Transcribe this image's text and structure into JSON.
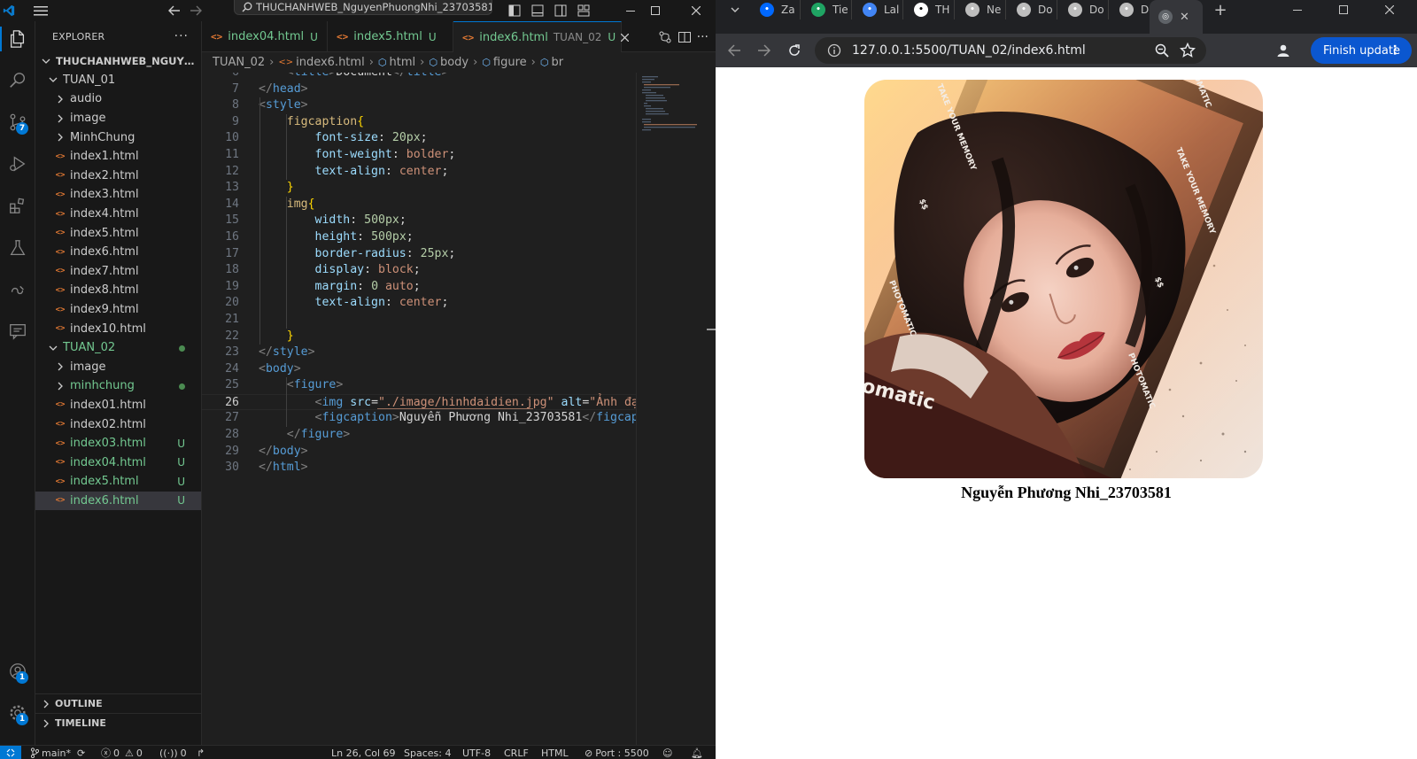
{
  "vscode": {
    "command_center": "THUCHANHWEB_NguyenPhuongNhi_23703581",
    "explorer_title": "EXPLORER",
    "root_folder": "THUCHANHWEB_NGUYENPH...",
    "scm_badge": "7",
    "accounts_badge": "1",
    "settings_badge": "1",
    "tree": [
      {
        "label": "TUAN_01",
        "type": "folder-open",
        "depth": 1
      },
      {
        "label": "audio",
        "type": "folder",
        "depth": 2
      },
      {
        "label": "image",
        "type": "folder",
        "depth": 2
      },
      {
        "label": "MinhChung",
        "type": "folder",
        "depth": 2
      },
      {
        "label": "index1.html",
        "type": "file",
        "depth": 2
      },
      {
        "label": "index2.html",
        "type": "file",
        "depth": 2
      },
      {
        "label": "index3.html",
        "type": "file",
        "depth": 2
      },
      {
        "label": "index4.html",
        "type": "file",
        "depth": 2
      },
      {
        "label": "index5.html",
        "type": "file",
        "depth": 2
      },
      {
        "label": "index6.html",
        "type": "file",
        "depth": 2
      },
      {
        "label": "index7.html",
        "type": "file",
        "depth": 2
      },
      {
        "label": "index8.html",
        "type": "file",
        "depth": 2
      },
      {
        "label": "index9.html",
        "type": "file",
        "depth": 2
      },
      {
        "label": "index10.html",
        "type": "file",
        "depth": 2
      },
      {
        "label": "TUAN_02",
        "type": "folder-open",
        "depth": 1,
        "status": "dot",
        "color": "#73c991"
      },
      {
        "label": "image",
        "type": "folder",
        "depth": 2
      },
      {
        "label": "minhchung",
        "type": "folder",
        "depth": 2,
        "status": "dot",
        "color": "#73c991"
      },
      {
        "label": "index01.html",
        "type": "file",
        "depth": 2
      },
      {
        "label": "index02.html",
        "type": "file",
        "depth": 2
      },
      {
        "label": "index03.html",
        "type": "file",
        "depth": 2,
        "status": "U",
        "color": "#73c991"
      },
      {
        "label": "index04.html",
        "type": "file",
        "depth": 2,
        "status": "U",
        "color": "#73c991"
      },
      {
        "label": "index5.html",
        "type": "file",
        "depth": 2,
        "status": "U",
        "color": "#73c991"
      },
      {
        "label": "index6.html",
        "type": "file",
        "depth": 2,
        "status": "U",
        "color": "#73c991",
        "selected": true
      }
    ],
    "outline_label": "OUTLINE",
    "timeline_label": "TIMELINE",
    "tabs": [
      {
        "name": "index04.html",
        "status": "U"
      },
      {
        "name": "index5.html",
        "status": "U"
      },
      {
        "name": "index6.html",
        "dir": "TUAN_02",
        "status": "U",
        "active": true
      }
    ],
    "breadcrumb": [
      "TUAN_02",
      "index6.html",
      "html",
      "body",
      "figure",
      "br"
    ],
    "code_lines": [
      {
        "n": "6",
        "tokens": [
          [
            "k-txt",
            "    "
          ],
          [
            "k-br",
            "<"
          ],
          [
            "k-tag",
            "title"
          ],
          [
            "k-br",
            ">"
          ],
          [
            "k-txt",
            "Document"
          ],
          [
            "k-br",
            "</"
          ],
          [
            "k-tag",
            "title"
          ],
          [
            "k-br",
            ">"
          ]
        ]
      },
      {
        "n": "7",
        "tokens": [
          [
            "k-br",
            "</"
          ],
          [
            "k-tag",
            "head"
          ],
          [
            "k-br",
            ">"
          ]
        ]
      },
      {
        "n": "8",
        "tokens": [
          [
            "k-br",
            "<"
          ],
          [
            "k-tag",
            "style"
          ],
          [
            "k-br",
            ">"
          ]
        ]
      },
      {
        "n": "9",
        "tokens": [
          [
            "k-txt",
            "    "
          ],
          [
            "k-sel",
            "figcaption"
          ],
          [
            "k-brace",
            "{"
          ]
        ]
      },
      {
        "n": "10",
        "tokens": [
          [
            "k-txt",
            "        "
          ],
          [
            "k-prop",
            "font-size"
          ],
          [
            "k-txt",
            ": "
          ],
          [
            "k-num",
            "20px"
          ],
          [
            "k-txt",
            ";"
          ]
        ]
      },
      {
        "n": "11",
        "tokens": [
          [
            "k-txt",
            "        "
          ],
          [
            "k-prop",
            "font-weight"
          ],
          [
            "k-txt",
            ": "
          ],
          [
            "k-val",
            "bolder"
          ],
          [
            "k-txt",
            ";"
          ]
        ]
      },
      {
        "n": "12",
        "tokens": [
          [
            "k-txt",
            "        "
          ],
          [
            "k-prop",
            "text-align"
          ],
          [
            "k-txt",
            ": "
          ],
          [
            "k-val",
            "center"
          ],
          [
            "k-txt",
            ";"
          ]
        ]
      },
      {
        "n": "13",
        "tokens": [
          [
            "k-txt",
            "    "
          ],
          [
            "k-brace",
            "}"
          ]
        ]
      },
      {
        "n": "14",
        "tokens": [
          [
            "k-txt",
            "    "
          ],
          [
            "k-sel",
            "img"
          ],
          [
            "k-brace",
            "{"
          ]
        ]
      },
      {
        "n": "15",
        "tokens": [
          [
            "k-txt",
            "        "
          ],
          [
            "k-prop",
            "width"
          ],
          [
            "k-txt",
            ": "
          ],
          [
            "k-num",
            "500px"
          ],
          [
            "k-txt",
            ";"
          ]
        ]
      },
      {
        "n": "16",
        "tokens": [
          [
            "k-txt",
            "        "
          ],
          [
            "k-prop",
            "height"
          ],
          [
            "k-txt",
            ": "
          ],
          [
            "k-num",
            "500px"
          ],
          [
            "k-txt",
            ";"
          ]
        ]
      },
      {
        "n": "17",
        "tokens": [
          [
            "k-txt",
            "        "
          ],
          [
            "k-prop",
            "border-radius"
          ],
          [
            "k-txt",
            ": "
          ],
          [
            "k-num",
            "25px"
          ],
          [
            "k-txt",
            ";"
          ]
        ]
      },
      {
        "n": "18",
        "tokens": [
          [
            "k-txt",
            "        "
          ],
          [
            "k-prop",
            "display"
          ],
          [
            "k-txt",
            ": "
          ],
          [
            "k-val",
            "block"
          ],
          [
            "k-txt",
            ";"
          ]
        ]
      },
      {
        "n": "19",
        "tokens": [
          [
            "k-txt",
            "        "
          ],
          [
            "k-prop",
            "margin"
          ],
          [
            "k-txt",
            ": "
          ],
          [
            "k-num",
            "0"
          ],
          [
            "k-txt",
            " "
          ],
          [
            "k-val",
            "auto"
          ],
          [
            "k-txt",
            ";"
          ]
        ]
      },
      {
        "n": "20",
        "tokens": [
          [
            "k-txt",
            "        "
          ],
          [
            "k-prop",
            "text-align"
          ],
          [
            "k-txt",
            ": "
          ],
          [
            "k-val",
            "center"
          ],
          [
            "k-txt",
            ";"
          ]
        ]
      },
      {
        "n": "21",
        "tokens": []
      },
      {
        "n": "22",
        "tokens": [
          [
            "k-txt",
            "    "
          ],
          [
            "k-brace",
            "}"
          ]
        ]
      },
      {
        "n": "23",
        "tokens": [
          [
            "k-br",
            "</"
          ],
          [
            "k-tag",
            "style"
          ],
          [
            "k-br",
            ">"
          ]
        ]
      },
      {
        "n": "24",
        "tokens": [
          [
            "k-br",
            "<"
          ],
          [
            "k-tag",
            "body"
          ],
          [
            "k-br",
            ">"
          ]
        ]
      },
      {
        "n": "25",
        "tokens": [
          [
            "k-txt",
            "    "
          ],
          [
            "k-br",
            "<"
          ],
          [
            "k-tag",
            "figure"
          ],
          [
            "k-br",
            ">"
          ]
        ]
      },
      {
        "n": "26",
        "current": true,
        "tokens": [
          [
            "k-txt",
            "        "
          ],
          [
            "k-br",
            "<"
          ],
          [
            "k-tag",
            "img"
          ],
          [
            "k-txt",
            " "
          ],
          [
            "k-attr",
            "src"
          ],
          [
            "k-txt",
            "="
          ],
          [
            "k-str",
            "\"./image/hinhdaidien.jpg\""
          ],
          [
            "k-txt",
            " "
          ],
          [
            "k-attr",
            "alt"
          ],
          [
            "k-txt",
            "="
          ],
          [
            "k-str",
            "\"Ảnh đại di"
          ]
        ]
      },
      {
        "n": "27",
        "tokens": [
          [
            "k-txt",
            "        "
          ],
          [
            "k-br",
            "<"
          ],
          [
            "k-tag",
            "figcaption"
          ],
          [
            "k-br",
            ">"
          ],
          [
            "k-txt",
            "Nguyễn Phương Nhi_23703581"
          ],
          [
            "k-br",
            "</"
          ],
          [
            "k-tag",
            "figcaption"
          ],
          [
            "k-br",
            ">"
          ]
        ]
      },
      {
        "n": "28",
        "tokens": [
          [
            "k-txt",
            "    "
          ],
          [
            "k-br",
            "</"
          ],
          [
            "k-tag",
            "figure"
          ],
          [
            "k-br",
            ">"
          ]
        ]
      },
      {
        "n": "29",
        "tokens": [
          [
            "k-br",
            "</"
          ],
          [
            "k-tag",
            "body"
          ],
          [
            "k-br",
            ">"
          ]
        ]
      },
      {
        "n": "30",
        "tokens": [
          [
            "k-br",
            "</"
          ],
          [
            "k-tag",
            "html"
          ],
          [
            "k-br",
            ">"
          ]
        ]
      }
    ],
    "status": {
      "branch": "main*",
      "errors": "0",
      "warnings": "0",
      "ports": "0",
      "position": "Ln 26, Col 69",
      "spaces": "Spaces: 4",
      "encoding": "UTF-8",
      "eol": "CRLF",
      "language": "HTML",
      "port": "Port : 5500"
    }
  },
  "chrome": {
    "tabs": [
      {
        "label": "Za",
        "icon": "zalo-icon",
        "color": "#0068ff"
      },
      {
        "label": "Tie",
        "icon": "drive-icon",
        "color": "#1fa463"
      },
      {
        "label": "Lal",
        "icon": "docs-icon",
        "color": "#4285f4"
      },
      {
        "label": "TH",
        "icon": "github-icon",
        "color": "#ffffff"
      },
      {
        "label": "Ne",
        "icon": "chrome-icon",
        "color": "#bdbdbd"
      },
      {
        "label": "Do",
        "icon": "globe-icon",
        "color": "#bdbdbd"
      },
      {
        "label": "Do",
        "icon": "globe-icon",
        "color": "#bdbdbd"
      },
      {
        "label": "Do",
        "icon": "globe-icon",
        "color": "#bdbdbd"
      }
    ],
    "url": "127.0.0.1:5500/TUAN_02/index6.html",
    "finish_update": "Finish update",
    "page": {
      "image_alt": "Ảnh đại diện",
      "caption": "Nguyễn Phương Nhi_23703581",
      "photo_text_1": "TAKE YOUR MEMORY",
      "photo_text_2": "TAKE YOUR MEMORY",
      "photo_text_3": "PHOTOMATIC",
      "photo_text_4": "PHOTOMATIC",
      "photo_text_5": "omatic",
      "photo_text_6": "OMATIC",
      "photo_text_7": "$$",
      "photo_text_8": "$$"
    }
  }
}
